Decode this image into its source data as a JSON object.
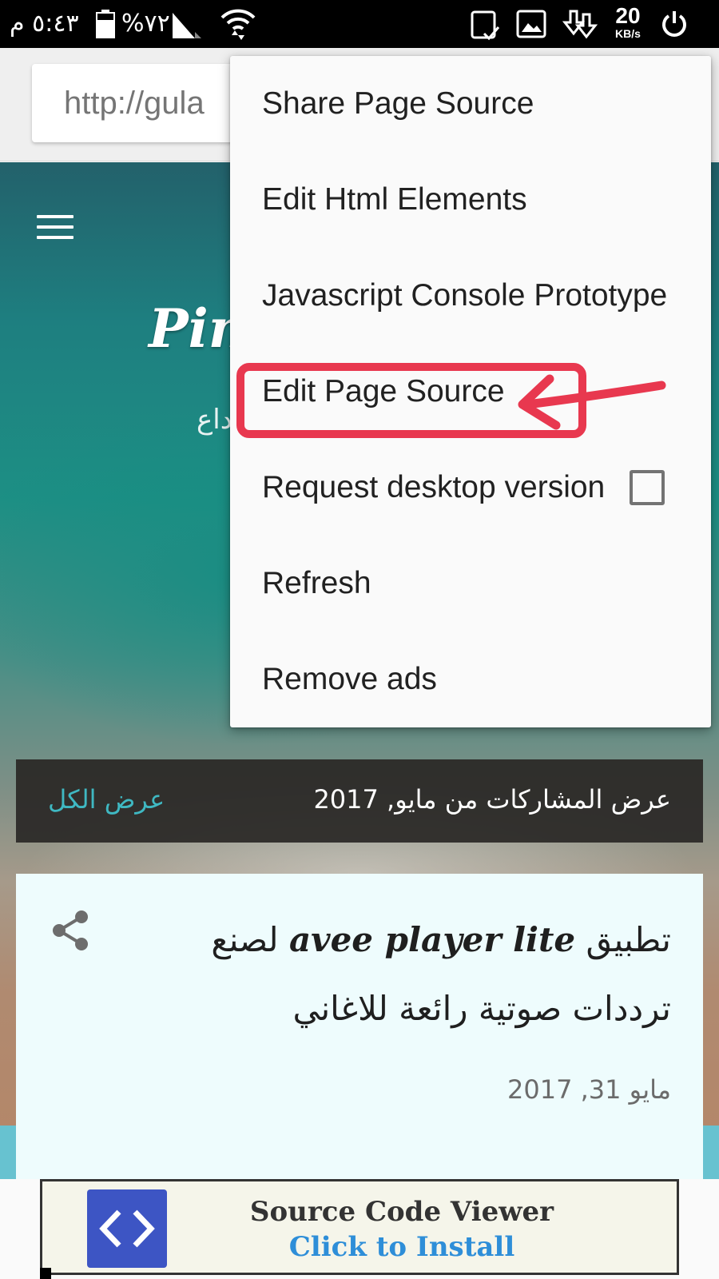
{
  "status_bar": {
    "time": "٥:٤٣ م",
    "battery": "%٧٢",
    "net_speed_value": "20",
    "net_speed_unit": "KB/s",
    "icons": [
      "battery-icon",
      "signal-icon",
      "wifi-icon",
      "screenshot-icon",
      "gallery-icon",
      "download-icon",
      "power-icon"
    ]
  },
  "browser": {
    "url": "http://gula"
  },
  "menu": {
    "items": [
      {
        "label": "Share Page Source"
      },
      {
        "label": "Edit Html Elements"
      },
      {
        "label": "Javascript Console Prototype"
      },
      {
        "label": "Edit Page Source"
      },
      {
        "label": "Request desktop version",
        "checkbox": false
      },
      {
        "label": "Refresh"
      },
      {
        "label": "Remove ads"
      }
    ]
  },
  "page": {
    "blog_title": "Pin",
    "blog_description": "داع",
    "filter_text": "عرض المشاركات من مايو, 2017",
    "filter_link": "عرض الكل",
    "post": {
      "title_prefix": "تطبيق",
      "app_name": "avee player lite",
      "title_suffix": "لصنع ترددات صوتية رائعة للاغاني",
      "date": "مايو 31, 2017"
    }
  },
  "ad": {
    "title": "Source Code Viewer",
    "cta": "Click to Install"
  },
  "colors": {
    "highlight": "#e8384f",
    "accent_link": "#3fb8c2",
    "ad_cta": "#2e8ed8",
    "ad_logo": "#3d55c4"
  }
}
